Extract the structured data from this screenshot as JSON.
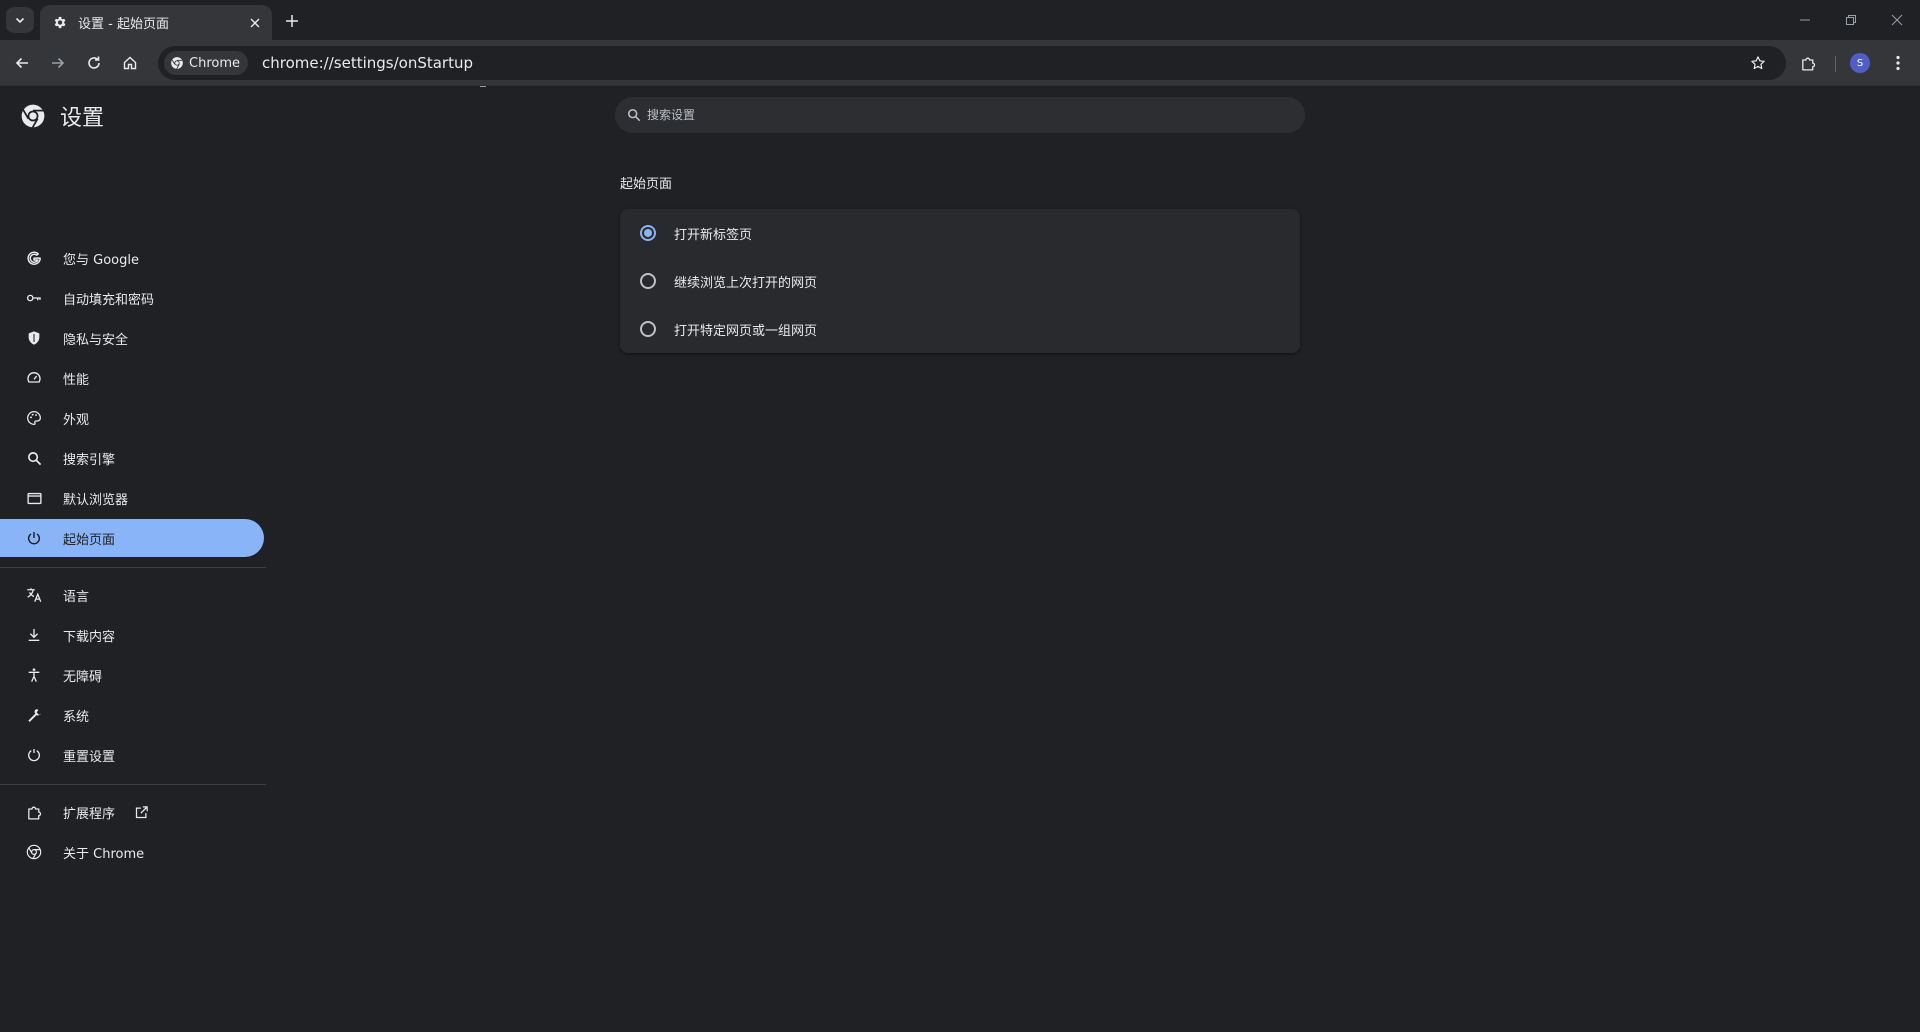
{
  "colors": {
    "accent": "#8ab4f8",
    "background": "#202124",
    "toolbar": "#35363a",
    "card": "#292a2d",
    "avatar": "#4f5ec9"
  },
  "tabstrip": {
    "tab_title": "设置 - 起始页面",
    "tab_icon": "gear-icon"
  },
  "toolbar": {
    "chip_label": "Chrome",
    "url": "chrome://settings/onStartup",
    "avatar_letter": "S"
  },
  "settings": {
    "title": "设置",
    "search_placeholder": "搜索设置",
    "nav": [
      {
        "label": "您与 Google",
        "icon": "google-g-icon"
      },
      {
        "label": "自动填充和密码",
        "icon": "key-icon"
      },
      {
        "label": "隐私与安全",
        "icon": "shield-icon"
      },
      {
        "label": "性能",
        "icon": "speedometer-icon"
      },
      {
        "label": "外观",
        "icon": "palette-icon"
      },
      {
        "label": "搜索引擎",
        "icon": "search-icon"
      },
      {
        "label": "默认浏览器",
        "icon": "browser-window-icon"
      },
      {
        "label": "起始页面",
        "icon": "power-icon",
        "active": true
      },
      {
        "label": "语言",
        "icon": "translate-icon"
      },
      {
        "label": "下载内容",
        "icon": "download-icon"
      },
      {
        "label": "无障碍",
        "icon": "accessibility-icon"
      },
      {
        "label": "系统",
        "icon": "wrench-icon"
      },
      {
        "label": "重置设置",
        "icon": "reset-icon"
      },
      {
        "label": "扩展程序",
        "icon": "puzzle-icon",
        "external_icon": "open-in-new-icon"
      },
      {
        "label": "关于 Chrome",
        "icon": "chrome-logo-icon"
      }
    ],
    "section_title": "起始页面",
    "startup_options": [
      {
        "label": "打开新标签页",
        "checked": true
      },
      {
        "label": "继续浏览上次打开的网页",
        "checked": false
      },
      {
        "label": "打开特定网页或一组网页",
        "checked": false
      }
    ]
  }
}
